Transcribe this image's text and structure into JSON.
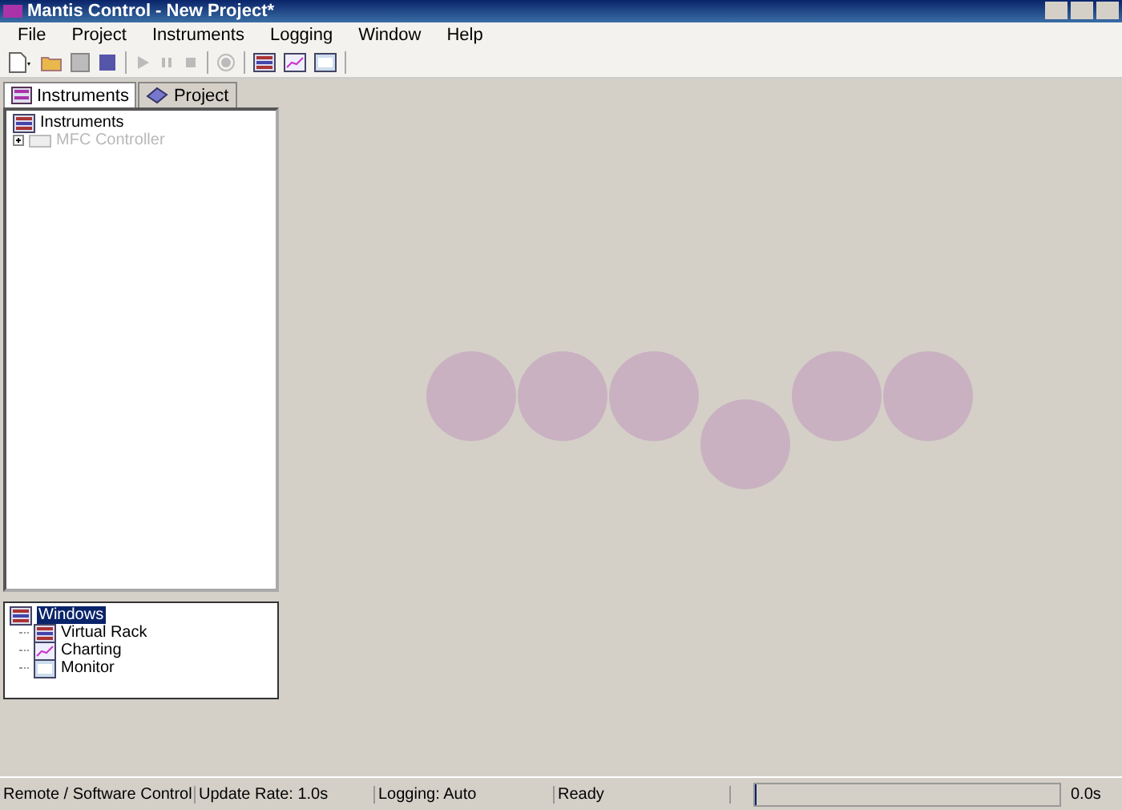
{
  "window": {
    "title": "Mantis Control - New Project*"
  },
  "menu": [
    "File",
    "Project",
    "Instruments",
    "Logging",
    "Window",
    "Help"
  ],
  "tabs": [
    {
      "label": "Instruments",
      "selected": true
    },
    {
      "label": "Project",
      "selected": false
    }
  ],
  "instrument_tree": {
    "label": "Instruments",
    "children": [
      {
        "label": "MFC Controller",
        "disabled": true,
        "expanded": false
      }
    ]
  },
  "windows_tree": {
    "label": "Windows",
    "selected": true,
    "children": [
      {
        "label": "Virtual Rack",
        "kind": "rack"
      },
      {
        "label": "Charting",
        "kind": "chart"
      },
      {
        "label": "Monitor",
        "kind": "monitor"
      }
    ]
  },
  "status_bar": {
    "fields": [
      "Remote / Software Control",
      "Update Rate: 1.0s",
      "Logging: Auto",
      "Ready"
    ],
    "progress": {
      "level": 0
    },
    "time": "0.0s"
  }
}
